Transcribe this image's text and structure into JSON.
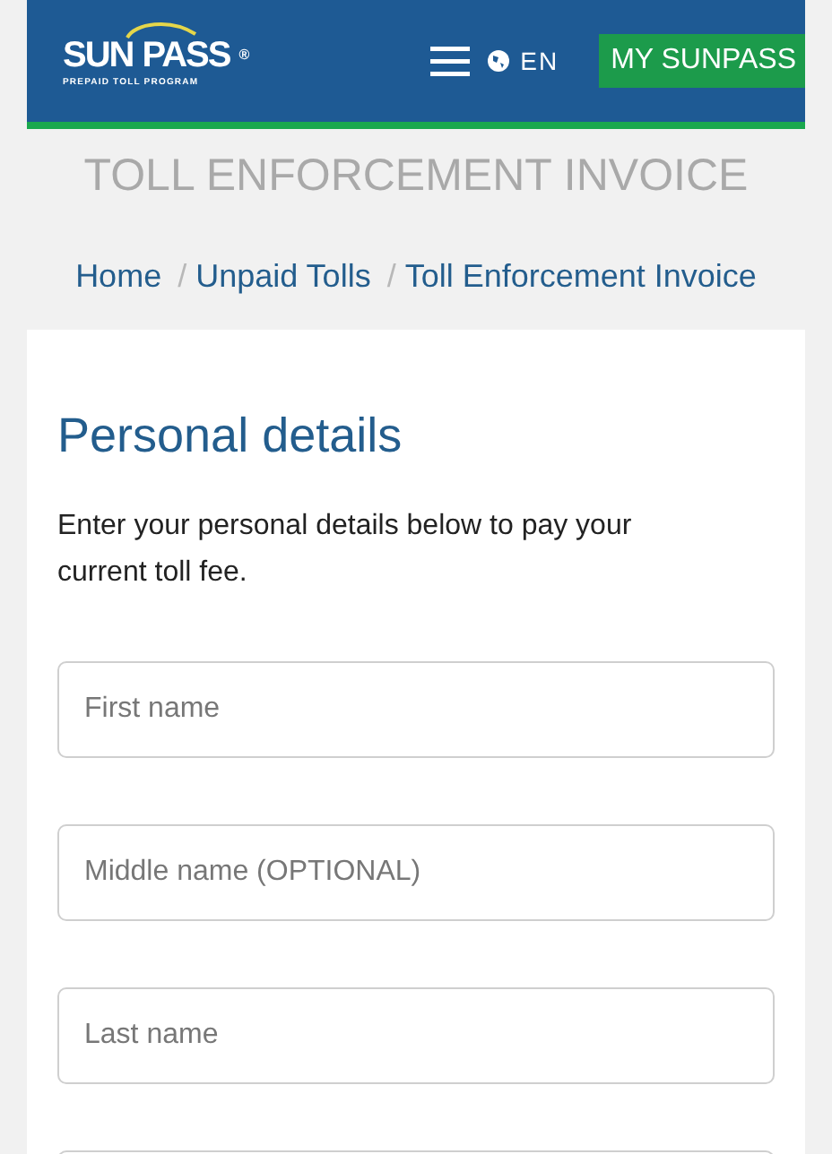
{
  "header": {
    "logo": {
      "word_1": "SUN",
      "word_2": "PASS",
      "registered": "®",
      "tagline": "PREPAID TOLL PROGRAM"
    },
    "language": "EN",
    "account_button": "MY SUNPASS"
  },
  "page_title": "TOLL ENFORCEMENT INVOICE",
  "breadcrumb": [
    {
      "label": "Home"
    },
    {
      "separator": "/",
      "label": "Unpaid Tolls"
    },
    {
      "separator": "/",
      "label": "Toll Enforcement Invoice"
    }
  ],
  "form": {
    "heading": "Personal details",
    "intro": "Enter your personal details below to pay your current toll fee.",
    "fields": [
      {
        "kind": "text",
        "placeholder": "First name"
      },
      {
        "kind": "text",
        "placeholder": "Middle name (OPTIONAL)"
      },
      {
        "kind": "text",
        "placeholder": "Last name"
      },
      {
        "kind": "text"
      }
    ]
  }
}
